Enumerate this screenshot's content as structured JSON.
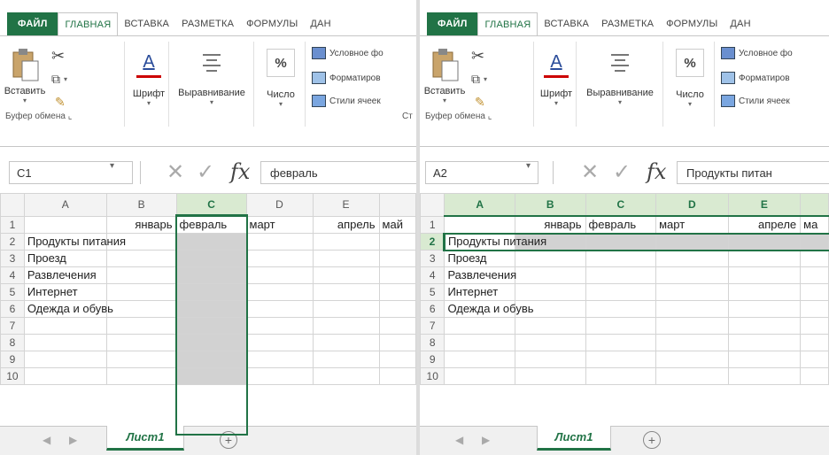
{
  "ribbon": {
    "tabs": [
      "ФАЙЛ",
      "ГЛАВНАЯ",
      "ВСТАВКА",
      "РАЗМЕТКА",
      "ФОРМУЛЫ",
      "ДАН"
    ],
    "paste_label": "Вставить",
    "font_label": "Шрифт",
    "align_label": "Выравнивание",
    "number_label": "Число",
    "percent_glyph": "%",
    "font_glyph": "A",
    "cond_format": "Условное фо",
    "format_table": "Форматиров",
    "cell_styles": "Стили ячеек",
    "clipboard_group": "Буфер обмена",
    "styles_group_left": "Ст"
  },
  "left": {
    "name_box": "C1",
    "formula_value": "февраль",
    "fx": "fx",
    "sheet_tab": "Лист1",
    "columns": [
      "A",
      "B",
      "C",
      "D",
      "E",
      ""
    ],
    "row_numbers": [
      "1",
      "2",
      "3",
      "4",
      "5",
      "6",
      "7",
      "8",
      "9",
      "10"
    ],
    "months_row": [
      "январь",
      "февраль",
      "март",
      "апрель",
      "май"
    ],
    "categories": [
      "Продукты питания",
      "Проезд",
      "Развлечения",
      "Интернет",
      "Одежда и обувь"
    ]
  },
  "right": {
    "name_box": "A2",
    "formula_value": "Продукты питан",
    "fx": "fx",
    "sheet_tab": "Лист1",
    "columns": [
      "A",
      "B",
      "C",
      "D",
      "E",
      ""
    ],
    "row_numbers": [
      "1",
      "2",
      "3",
      "4",
      "5",
      "6",
      "7",
      "8",
      "9",
      "10"
    ],
    "months_row": [
      "январь",
      "февраль",
      "март",
      "апреле",
      "ма"
    ],
    "categories": [
      "Продукты питания",
      "Проезд",
      "Развлечения",
      "Интернет",
      "Одежда и обувь"
    ]
  },
  "colors": {
    "accent": "#217346",
    "selection": "#d2d2d2",
    "header_highlight": "#d9ead1"
  },
  "icons": [
    "paste-icon",
    "cut-icon",
    "copy-icon",
    "format-painter-icon",
    "font-icon",
    "align-icon",
    "percent-icon",
    "conditional-format-icon",
    "format-table-icon",
    "cell-styles-icon",
    "cancel-icon",
    "enter-icon",
    "fx-icon",
    "add-sheet-icon"
  ]
}
